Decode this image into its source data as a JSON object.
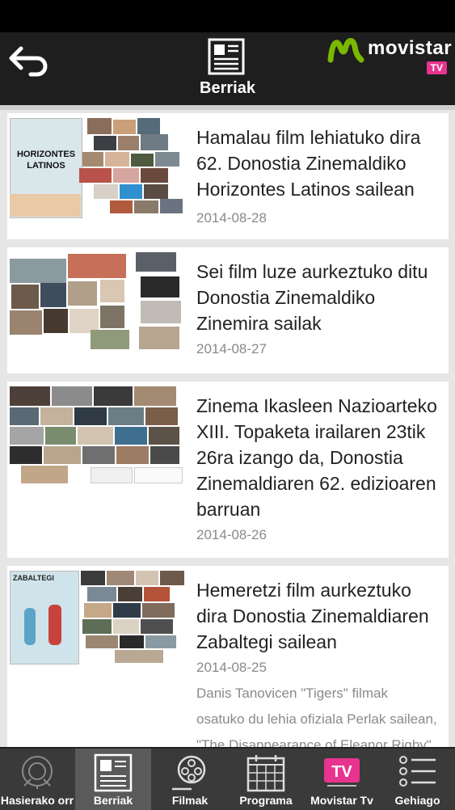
{
  "header": {
    "title": "Berriak",
    "back_icon": "back-arrow-icon",
    "page_icon": "newspaper-icon",
    "brand": {
      "name": "movistar",
      "badge": "TV",
      "logo_color": "#7ab800"
    }
  },
  "news": [
    {
      "title": "Hamalau film lehiatuko dira 62. Donostia Zinemaldiko Horizontes Latinos sailean",
      "date": "2014-08-28",
      "poster_text": "HORIZONTES LATINOS"
    },
    {
      "title": "Sei film luze aurkeztuko ditu Donostia Zinemaldiko Zinemira sailak",
      "date": "2014-08-27"
    },
    {
      "title": "Zinema Ikasleen Nazioarteko XIII. Topaketa irailaren 23tik 26ra izango da, Donostia Zinemaldiaren 62. edizioaren barruan",
      "date": "2014-08-26"
    },
    {
      "title": "Hemeretzi film aurkeztuko dira Donostia Zinemaldiaren Zabaltegi sailean",
      "date": "2014-08-25",
      "poster_text": "ZABALTEGI",
      "excerpt": "Danis Tanovicen \"Tigers\" filmak osatuko du lehia ofiziala Perlak sailean, \"The Disappearance of Eleanor Rigby\" filma..."
    }
  ],
  "nav": [
    {
      "label": "Hasierako orr",
      "icon": "festival-emblem-icon"
    },
    {
      "label": "Berriak",
      "icon": "newspaper-icon",
      "active": true
    },
    {
      "label": "Filmak",
      "icon": "film-reel-icon"
    },
    {
      "label": "Programa",
      "icon": "calendar-icon"
    },
    {
      "label": "Movistar Tv",
      "icon": "tv-badge-icon"
    },
    {
      "label": "Gehiago",
      "icon": "more-list-icon"
    }
  ],
  "colors": {
    "accent_pink": "#e8338f",
    "header_bg": "#1e1e1e",
    "nav_bg": "#3a3a3a"
  }
}
